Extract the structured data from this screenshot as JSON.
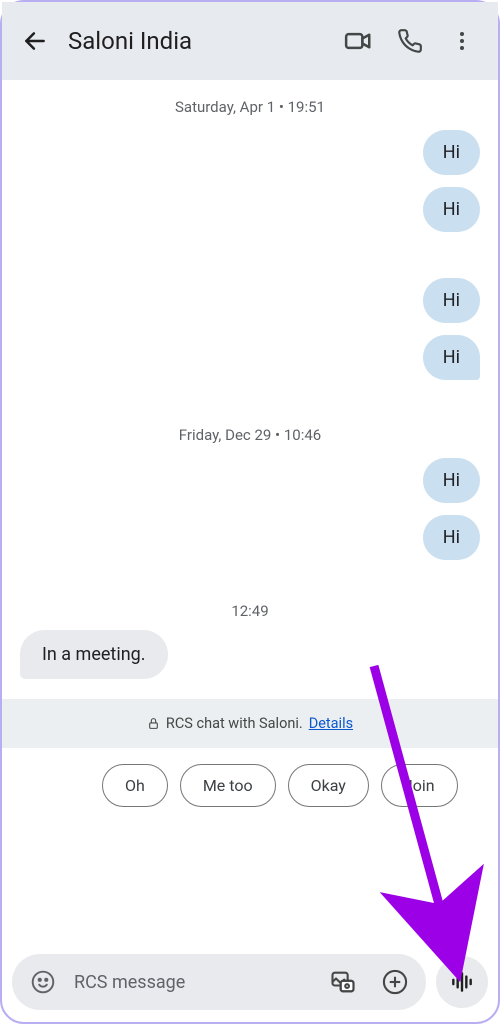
{
  "header": {
    "contact_name": "Saloni India"
  },
  "conversation": {
    "groups": [
      {
        "divider": "Saturday, Apr 1 • 19:51",
        "messages": [
          {
            "dir": "out",
            "text": "Hi",
            "tail": false
          },
          {
            "dir": "out",
            "text": "Hi",
            "tail": false
          },
          {
            "dir": "out",
            "text": "Hi",
            "tail": false
          },
          {
            "dir": "out",
            "text": "Hi",
            "tail": true
          }
        ]
      },
      {
        "divider": "Friday, Dec 29 • 10:46",
        "messages": [
          {
            "dir": "out",
            "text": "Hi",
            "tail": false
          },
          {
            "dir": "out",
            "text": "Hi",
            "tail": false
          }
        ]
      }
    ],
    "time_marker": "12:49",
    "incoming": {
      "text": "In a meeting."
    }
  },
  "rcs_banner": {
    "prefix": "RCS chat with Saloni.",
    "details": "Details"
  },
  "suggestions": [
    "Oh",
    "Me too",
    "Okay",
    "Join"
  ],
  "composer": {
    "placeholder": "RCS message"
  }
}
